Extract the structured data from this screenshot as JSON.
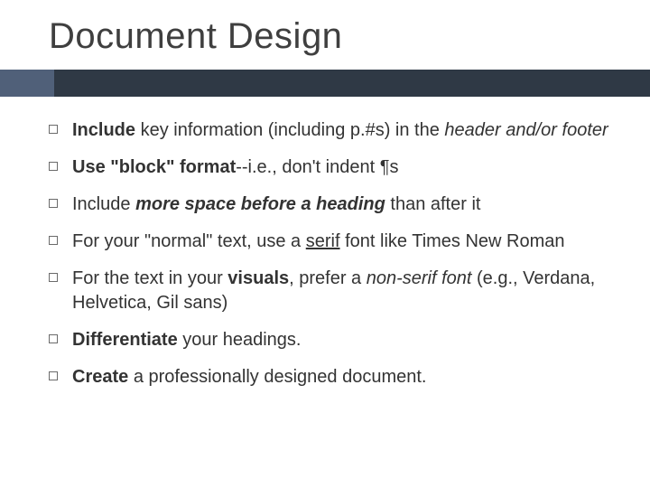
{
  "title": "Document Design",
  "bullets": [
    {
      "html": "<b>Include</b> key information (including p.#s) in the <i>header and/or footer</i>"
    },
    {
      "html": "<b>Use \"block\" format</b>--i.e., don't indent ¶s"
    },
    {
      "html": "Include <span class=\"bi\">more space before a heading</span> than after it"
    },
    {
      "html": "For your \"normal\" text, use a <span class=\"u\">serif</span> font like Times New Roman"
    },
    {
      "html": "For the text in your <b>visuals</b>, prefer a <i>non-serif font</i> (e.g., Verdana, Helvetica, Gil sans)"
    },
    {
      "html": "<b>Differentiate</b> your headings."
    },
    {
      "html": "<b>Create</b> a professionally designed document."
    }
  ]
}
